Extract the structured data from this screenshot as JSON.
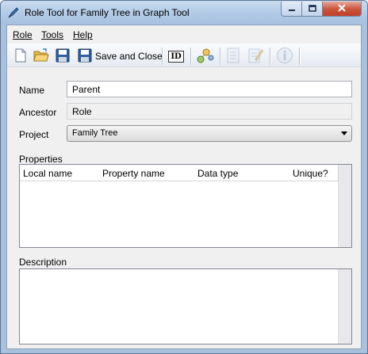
{
  "window": {
    "title": "Role Tool for Family Tree in Graph Tool",
    "app_icon": "pen-icon"
  },
  "menu": {
    "items": [
      {
        "label": "Role",
        "mnemonic_index": 0
      },
      {
        "label": "Tools",
        "mnemonic_index": 0
      },
      {
        "label": "Help",
        "mnemonic_index": 0
      }
    ]
  },
  "toolbar": {
    "new_icon": "new-document-icon",
    "open_icon": "open-folder-icon",
    "save_icon": "floppy-disk-icon",
    "save_close_icon": "floppy-disk-icon",
    "save_close_label": "Save and Close",
    "id_label": "ID",
    "graph_icon": "graph-nodes-icon",
    "doc_icon": "document-icon",
    "edit_doc_icon": "edit-document-icon",
    "info_icon": "info-icon"
  },
  "form": {
    "name_label": "Name",
    "name_value": "Parent",
    "ancestor_label": "Ancestor",
    "ancestor_value": "Role",
    "project_label": "Project",
    "project_value": "Family Tree",
    "properties_label": "Properties",
    "columns": [
      "Local name",
      "Property name",
      "Data type",
      "Unique?"
    ],
    "description_label": "Description",
    "description_value": ""
  },
  "colors": {
    "title_bar": "#b3cbe7",
    "close_button": "#c9533c",
    "client_bg": "#f0f0f0"
  }
}
